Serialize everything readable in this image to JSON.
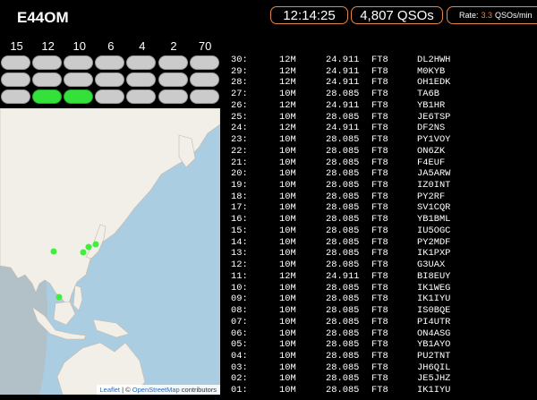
{
  "header": {
    "callsign": "E44OM",
    "clock": "12:14:25",
    "qso_count": "4,807 QSOs",
    "rate_label": "Rate:",
    "rate_value": "3.3",
    "rate_unit": "QSOs/min"
  },
  "bands": {
    "labels": [
      "15",
      "12",
      "10",
      "6",
      "4",
      "2",
      "70"
    ],
    "rows": [
      [
        false,
        false,
        false,
        false,
        false,
        false,
        false
      ],
      [
        false,
        false,
        false,
        false,
        false,
        false,
        false
      ],
      [
        false,
        true,
        true,
        false,
        false,
        false,
        false
      ]
    ]
  },
  "map": {
    "attribution_leaflet": "Leaflet",
    "attribution_sep": " | © ",
    "attribution_osm": "OpenStreetMap",
    "attribution_tail": " contributors",
    "colors": {
      "ocean": "#aacde2",
      "land": "#f2efe9",
      "spot": "#3df03d",
      "terminator": "#b8b8b0"
    }
  },
  "log": [
    {
      "n": "30:",
      "band": "12M",
      "freq": "24.911",
      "mode": "FT8",
      "call": "DL2HWH"
    },
    {
      "n": "29:",
      "band": "12M",
      "freq": "24.911",
      "mode": "FT8",
      "call": "M0KYB"
    },
    {
      "n": "28:",
      "band": "12M",
      "freq": "24.911",
      "mode": "FT8",
      "call": "OH1EDK"
    },
    {
      "n": "27:",
      "band": "10M",
      "freq": "28.085",
      "mode": "FT8",
      "call": "TA6B"
    },
    {
      "n": "26:",
      "band": "12M",
      "freq": "24.911",
      "mode": "FT8",
      "call": "YB1HR"
    },
    {
      "n": "25:",
      "band": "10M",
      "freq": "28.085",
      "mode": "FT8",
      "call": "JE6TSP"
    },
    {
      "n": "24:",
      "band": "12M",
      "freq": "24.911",
      "mode": "FT8",
      "call": "DF2NS"
    },
    {
      "n": "23:",
      "band": "10M",
      "freq": "28.085",
      "mode": "FT8",
      "call": "PY1VOY"
    },
    {
      "n": "22:",
      "band": "10M",
      "freq": "28.085",
      "mode": "FT8",
      "call": "ON6ZK"
    },
    {
      "n": "21:",
      "band": "10M",
      "freq": "28.085",
      "mode": "FT8",
      "call": "F4EUF"
    },
    {
      "n": "20:",
      "band": "10M",
      "freq": "28.085",
      "mode": "FT8",
      "call": "JA5ARW"
    },
    {
      "n": "19:",
      "band": "10M",
      "freq": "28.085",
      "mode": "FT8",
      "call": "IZ0INT"
    },
    {
      "n": "18:",
      "band": "10M",
      "freq": "28.085",
      "mode": "FT8",
      "call": "PY2RF"
    },
    {
      "n": "17:",
      "band": "10M",
      "freq": "28.085",
      "mode": "FT8",
      "call": "SV1CQR"
    },
    {
      "n": "16:",
      "band": "10M",
      "freq": "28.085",
      "mode": "FT8",
      "call": "YB1BML"
    },
    {
      "n": "15:",
      "band": "10M",
      "freq": "28.085",
      "mode": "FT8",
      "call": "IU5OGC"
    },
    {
      "n": "14:",
      "band": "10M",
      "freq": "28.085",
      "mode": "FT8",
      "call": "PY2MDF"
    },
    {
      "n": "13:",
      "band": "10M",
      "freq": "28.085",
      "mode": "FT8",
      "call": "IK1PXP"
    },
    {
      "n": "12:",
      "band": "10M",
      "freq": "28.085",
      "mode": "FT8",
      "call": "G3UAX"
    },
    {
      "n": "11:",
      "band": "12M",
      "freq": "24.911",
      "mode": "FT8",
      "call": "BI8EUY"
    },
    {
      "n": "10:",
      "band": "10M",
      "freq": "28.085",
      "mode": "FT8",
      "call": "IK1WEG"
    },
    {
      "n": "09:",
      "band": "10M",
      "freq": "28.085",
      "mode": "FT8",
      "call": "IK1IYU"
    },
    {
      "n": "08:",
      "band": "10M",
      "freq": "28.085",
      "mode": "FT8",
      "call": "IS0BQE"
    },
    {
      "n": "07:",
      "band": "10M",
      "freq": "28.085",
      "mode": "FT8",
      "call": "PI4UTR"
    },
    {
      "n": "06:",
      "band": "10M",
      "freq": "28.085",
      "mode": "FT8",
      "call": "ON4ASG"
    },
    {
      "n": "05:",
      "band": "10M",
      "freq": "28.085",
      "mode": "FT8",
      "call": "YB1AYO"
    },
    {
      "n": "04:",
      "band": "10M",
      "freq": "28.085",
      "mode": "FT8",
      "call": "PU2TNT"
    },
    {
      "n": "03:",
      "band": "10M",
      "freq": "28.085",
      "mode": "FT8",
      "call": "JH6QIL"
    },
    {
      "n": "02:",
      "band": "10M",
      "freq": "28.085",
      "mode": "FT8",
      "call": "JE5JHZ"
    },
    {
      "n": "01:",
      "band": "10M",
      "freq": "28.085",
      "mode": "FT8",
      "call": "IK1IYU"
    }
  ]
}
